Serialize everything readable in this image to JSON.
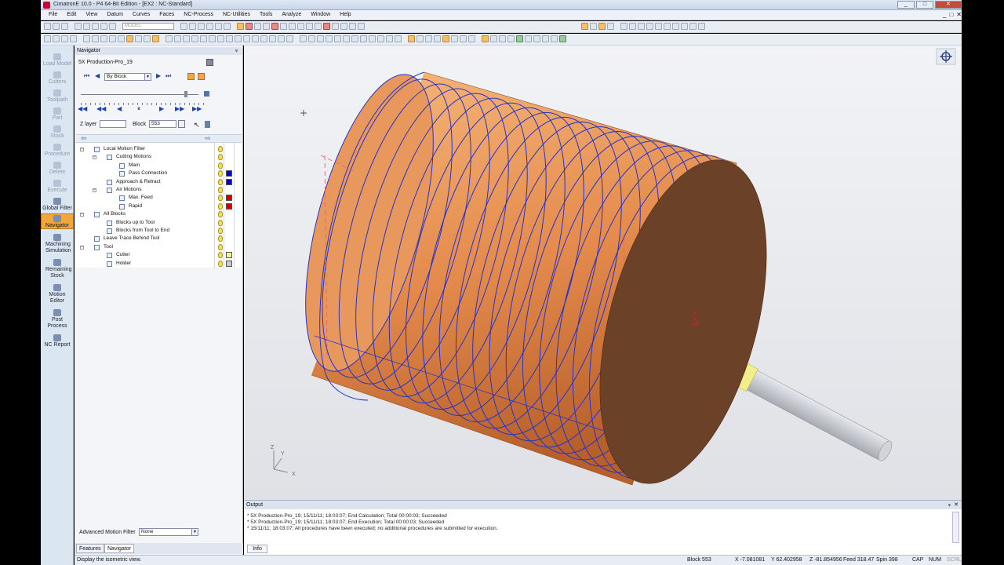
{
  "window": {
    "title": "CimatronE 10.0 - P4 64-Bit Edition - [EX2 : NC-Standard]",
    "controls": [
      "_",
      "□",
      "✕"
    ]
  },
  "menu": {
    "items": [
      "File",
      "Edit",
      "View",
      "Datum",
      "Curves",
      "Faces",
      "NC-Process",
      "NC-Utilities",
      "Tools",
      "Analyze",
      "Window",
      "Help"
    ],
    "mdi_controls": [
      "_",
      "□",
      "✕"
    ]
  },
  "toolbar": {
    "model_combo": "MODEL"
  },
  "sidebar": {
    "items": [
      {
        "label": "Load Model",
        "state": "disabled"
      },
      {
        "label": "Cutters",
        "state": "disabled"
      },
      {
        "label": "Toolpath",
        "state": "disabled"
      },
      {
        "label": "Part",
        "state": "disabled"
      },
      {
        "label": "Stock",
        "state": "disabled"
      },
      {
        "label": "Procedure",
        "state": "disabled"
      },
      {
        "label": "Delete",
        "state": "disabled"
      },
      {
        "label": "Execute",
        "state": "disabled"
      },
      {
        "label": "Global Filter",
        "state": "enabled"
      },
      {
        "label": "Navigator",
        "state": "active"
      },
      {
        "label": "Machining Simulation",
        "state": "enabled"
      },
      {
        "label": "Remaining Stock",
        "state": "enabled"
      },
      {
        "label": "Motion Editor",
        "state": "enabled"
      },
      {
        "label": "Post Process",
        "state": "enabled"
      },
      {
        "label": "NC Report",
        "state": "enabled"
      }
    ]
  },
  "navigator": {
    "title": "Navigator",
    "pin": "ᵩ",
    "procedure": "5X Production-Pro_19",
    "step_mode": "By Block",
    "layer_label": "Z layer",
    "block_label": "Block",
    "block_value": "553",
    "tree": [
      {
        "label": "Local Motion Filter",
        "level": 0,
        "toggle": "−",
        "bulb": true,
        "color": ""
      },
      {
        "label": "Cutting Motions",
        "level": 1,
        "toggle": "−",
        "bulb": true,
        "color": ""
      },
      {
        "label": "Main",
        "level": 2,
        "toggle": "",
        "bulb": true,
        "color": ""
      },
      {
        "label": "Pass Connection",
        "level": 2,
        "toggle": "",
        "bulb": true,
        "color": "#0000cc"
      },
      {
        "label": "Approach & Retract",
        "level": 1,
        "toggle": "",
        "bulb": true,
        "color": "#0000cc"
      },
      {
        "label": "Air Motions",
        "level": 1,
        "toggle": "−",
        "bulb": true,
        "color": ""
      },
      {
        "label": "Max. Feed",
        "level": 2,
        "toggle": "",
        "bulb": true,
        "color": "#cc0000"
      },
      {
        "label": "Rapid",
        "level": 2,
        "toggle": "",
        "bulb": true,
        "color": "#cc0000"
      },
      {
        "label": "All Blocks",
        "level": 0,
        "toggle": "−",
        "bulb": true,
        "color": ""
      },
      {
        "label": "Blocks up to Tool",
        "level": 1,
        "toggle": "",
        "bulb": true,
        "color": ""
      },
      {
        "label": "Blocks from Tool to End",
        "level": 1,
        "toggle": "",
        "bulb": true,
        "color": ""
      },
      {
        "label": "Leave Trace Behind Tool",
        "level": 0,
        "toggle": "",
        "bulb": true,
        "color": ""
      },
      {
        "label": "Tool",
        "level": 0,
        "toggle": "−",
        "bulb": true,
        "color": ""
      },
      {
        "label": "Cutter",
        "level": 1,
        "toggle": "",
        "bulb": true,
        "color": "#f7ee9a"
      },
      {
        "label": "Holder",
        "level": 1,
        "toggle": "",
        "bulb": true,
        "color": "#c8c8c8"
      }
    ],
    "advanced_filter_label": "Advanced Motion Filter",
    "advanced_filter_value": "None"
  },
  "bottom_tabs": {
    "features": "Features",
    "navigator": "Navigator"
  },
  "viewport": {
    "axis_labels": {
      "z": "Z",
      "y": "Y",
      "x": "X"
    },
    "colors": {
      "part": "#e08a4d",
      "face": "#6b4228",
      "path": "#2633c7",
      "cutter": "#f3ee8a",
      "holder": "#c4c6cc",
      "dashed": "#e06060"
    }
  },
  "output": {
    "title": "Output",
    "controls": [
      "ᵩ",
      "✕"
    ],
    "lines": [
      "* 5X Production-Pro_19; 15/11/11; 18:03:07; End Calculation; Total 00:00:03; Succeeded",
      "* 5X Production-Pro_19; 15/11/11; 18:03:07; End Execution; Total 00:00:03; Succeeded",
      "* 15/11/11; 18:03:07; All procedures have been executed; no additional procedures are submitted for execution."
    ],
    "tab": "Info"
  },
  "status": {
    "message": "Display the isometric view.",
    "block": "Block  553",
    "x": "X  -7.081081",
    "y": "Y  62.402958",
    "z": "Z  -81.854956",
    "feed": "Feed  318.47",
    "spin": "Spin  398",
    "cap": "CAP",
    "num": "NUM",
    "scrl": "SCRL"
  }
}
